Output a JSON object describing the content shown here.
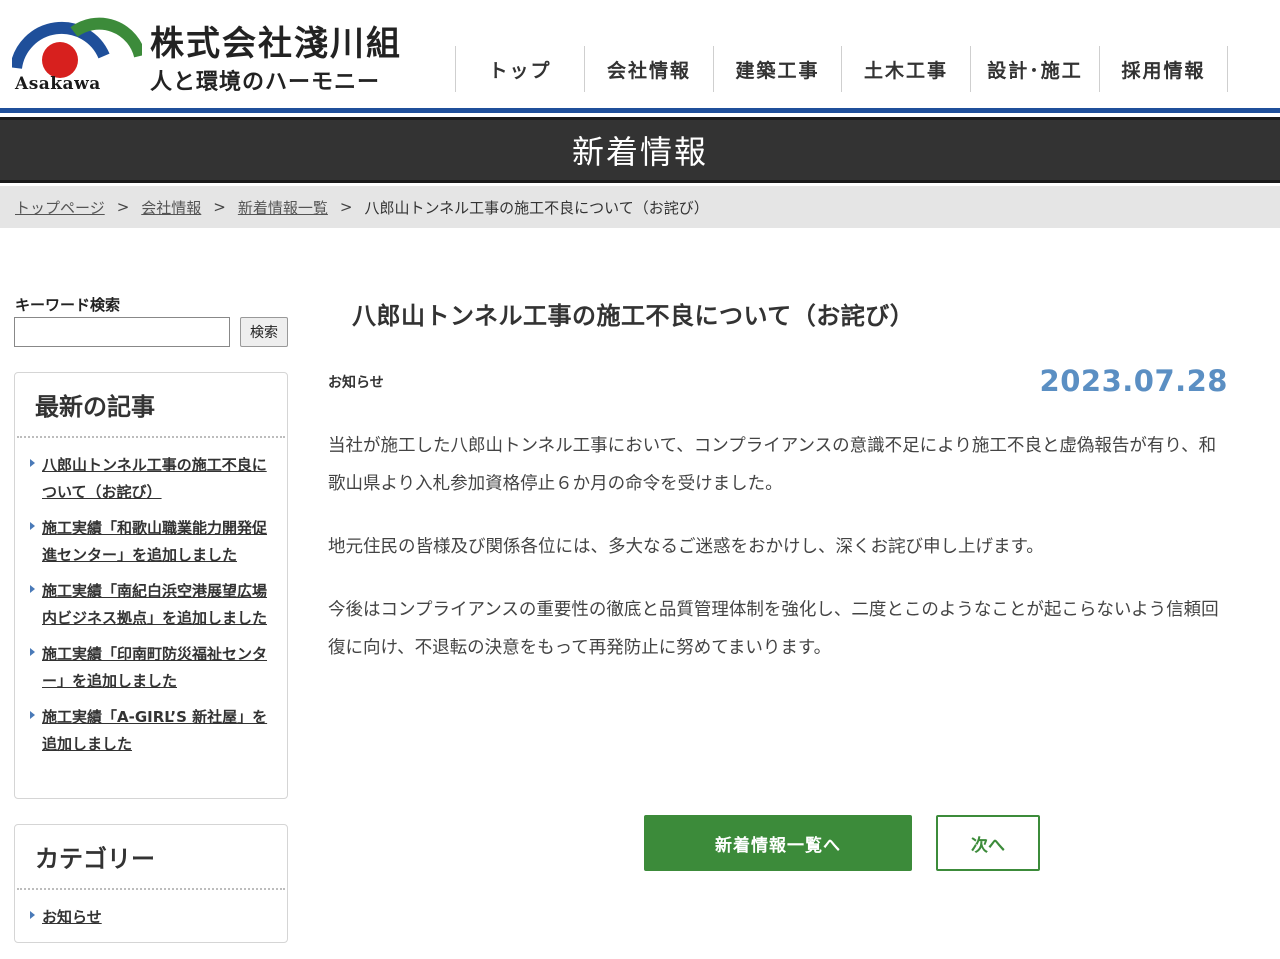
{
  "header": {
    "logo_text": "Asakawa",
    "company_name": "株式会社淺川組",
    "slogan": "人と環境のハーモニー",
    "colors": {
      "logo_blue": "#1f4f9a",
      "logo_green": "#3c8b3a",
      "logo_red": "#d7201e"
    }
  },
  "nav": {
    "items": [
      {
        "label": "トップ"
      },
      {
        "label": "会社情報"
      },
      {
        "label": "建築工事"
      },
      {
        "label": "土木工事"
      },
      {
        "label": "設計･施工"
      },
      {
        "label": "採用情報"
      }
    ]
  },
  "page_title": "新着情報",
  "breadcrumb": {
    "items": [
      {
        "label": "トップページ"
      },
      {
        "label": "会社情報"
      },
      {
        "label": "新着情報一覧"
      }
    ],
    "separator": ">",
    "current": "八郎山トンネル工事の施工不良について（お詫び）"
  },
  "sidebar": {
    "search": {
      "label": "キーワード検索",
      "value": "",
      "placeholder": "",
      "button_label": "検索"
    },
    "recent": {
      "title": "最新の記事",
      "items": [
        {
          "label": "八郎山トンネル工事の施工不良について（お詫び）"
        },
        {
          "label": "施工実績「和歌山職業能力開発促進センター」を追加しました"
        },
        {
          "label": "施工実績「南紀白浜空港展望広場内ビジネス拠点」を追加しました"
        },
        {
          "label": "施工実績「印南町防災福祉センター」を追加しました"
        },
        {
          "label": "施工実績「A-GIRL’S 新社屋」を追加しました"
        }
      ]
    },
    "categories": {
      "title": "カテゴリー",
      "items": [
        {
          "label": "お知らせ"
        }
      ]
    }
  },
  "article": {
    "title": "八郎山トンネル工事の施工不良について（お詫び）",
    "category": "お知らせ",
    "date": "2023.07.28",
    "paragraphs": [
      "当社が施工した八郎山トンネル工事において、コンプライアンスの意識不足により施工不良と虚偽報告が有り、和歌山県より入札参加資格停止６か月の命令を受けました。",
      "地元住民の皆様及び関係各位には、多大なるご迷惑をおかけし、深くお詫び申し上げます。",
      "今後はコンプライアンスの重要性の徹底と品質管理体制を強化し、二度とこのようなことが起こらないよう信頼回復に向け、不退転の決意をもって再発防止に努めてまいります。"
    ],
    "buttons": {
      "list_label": "新着情報一覧へ",
      "next_label": "次へ"
    }
  }
}
